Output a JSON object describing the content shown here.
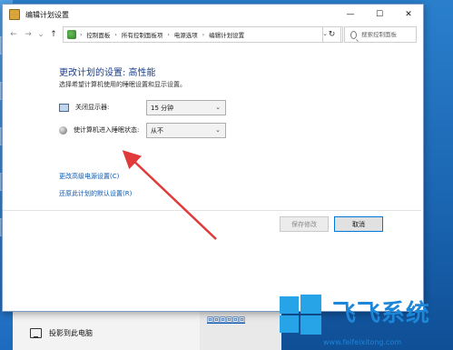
{
  "window": {
    "title": "编辑计划设置",
    "controls": {
      "minimize": "—",
      "maximize": "☐",
      "close": "✕"
    }
  },
  "nav": {
    "back": "←",
    "forward": "→",
    "recent": "⌄",
    "up": "↑",
    "breadcrumbs": [
      "控制面板",
      "所有控制面板项",
      "电源选项",
      "编辑计划设置"
    ],
    "breadcrumb_sep": "›",
    "dropdown": "⌄",
    "refresh": "↻",
    "search_placeholder": "搜索控制面板"
  },
  "main": {
    "heading": "更改计划的设置: 高性能",
    "subheading": "选择希望计算机使用的睡眠设置和显示设置。",
    "settings": [
      {
        "label": "关闭显示器:",
        "value": "15 分钟",
        "icon": "monitor-icon"
      },
      {
        "label": "使计算机进入睡眠状态:",
        "value": "从不",
        "icon": "moon-icon"
      }
    ],
    "links": {
      "advanced": "更改高级电源设置(C)",
      "restore": "还原此计划的默认设置(R)"
    },
    "buttons": {
      "save": "保存修改",
      "cancel": "取消"
    }
  },
  "background": {
    "project_label": "投影到此电脑",
    "partial_link": "回回回回回回"
  },
  "watermark": {
    "text": "飞飞系统",
    "url": "www.feifeixitong.com",
    "logo_color": "#27a3e8"
  },
  "annotation": {
    "color": "#e03a3a"
  }
}
